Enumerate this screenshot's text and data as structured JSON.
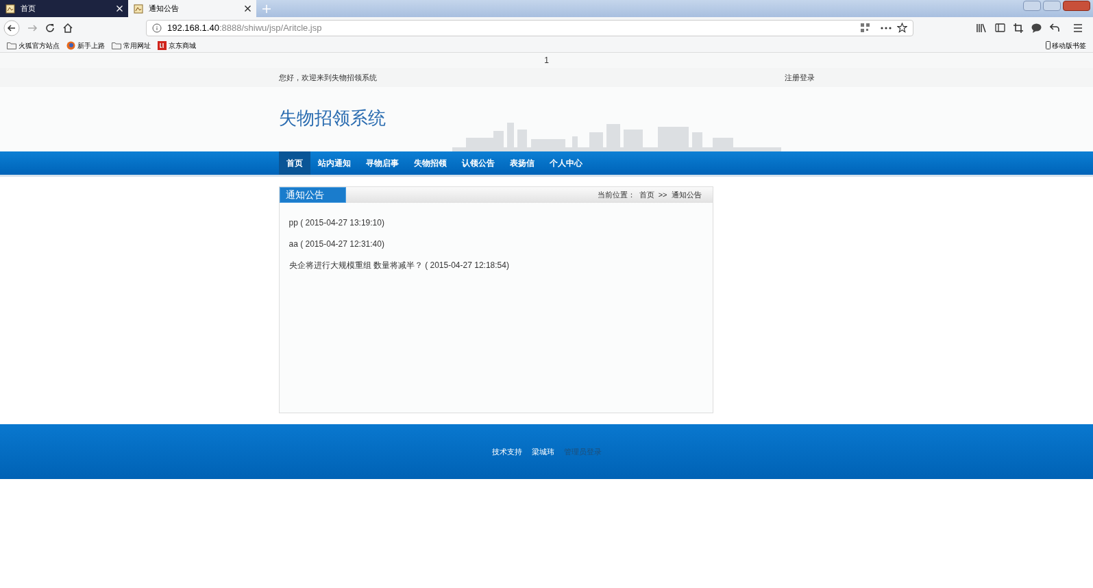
{
  "browser": {
    "tabs": [
      {
        "label": "首页",
        "selected": false
      },
      {
        "label": "通知公告",
        "selected": true
      }
    ],
    "address": {
      "host": "192.168.1.40",
      "rest": ":8888/shiwu/jsp/Aritcle.jsp"
    },
    "bookmarks": [
      {
        "label": "火狐官方站点",
        "kind": "folder"
      },
      {
        "label": "新手上路",
        "kind": "globe"
      },
      {
        "label": "常用网址",
        "kind": "folder"
      },
      {
        "label": "京东商城",
        "kind": "jd"
      }
    ],
    "mobile_bookmarks": "移动版书签"
  },
  "page": {
    "top_text": "1",
    "welcome": "您好，欢迎来到失物招领系统",
    "login_link": "注册登录",
    "site_title": "失物招领系统",
    "nav": [
      {
        "label": "首页",
        "selected": true
      },
      {
        "label": "站内通知",
        "selected": false
      },
      {
        "label": "寻物启事",
        "selected": false
      },
      {
        "label": "失物招领",
        "selected": false
      },
      {
        "label": "认领公告",
        "selected": false
      },
      {
        "label": "表扬信",
        "selected": false
      },
      {
        "label": "个人中心",
        "selected": false
      }
    ],
    "panel": {
      "title": "通知公告",
      "breadcrumb_label": "当前位置：",
      "breadcrumb": [
        "首页",
        ">>",
        "通知公告"
      ],
      "items": [
        {
          "title": "pp",
          "time": "( 2015-04-27 13:19:10)"
        },
        {
          "title": "aa",
          "time": "( 2015-04-27 12:31:40)"
        },
        {
          "title": "央企将进行大规模重组 数量将减半？",
          "time": "( 2015-04-27 12:18:54)"
        }
      ]
    },
    "footer": [
      {
        "label": "技术支持",
        "kind": "text"
      },
      {
        "label": "梁城玮",
        "kind": "text"
      },
      {
        "label": "管理员登录",
        "kind": "link"
      }
    ]
  }
}
